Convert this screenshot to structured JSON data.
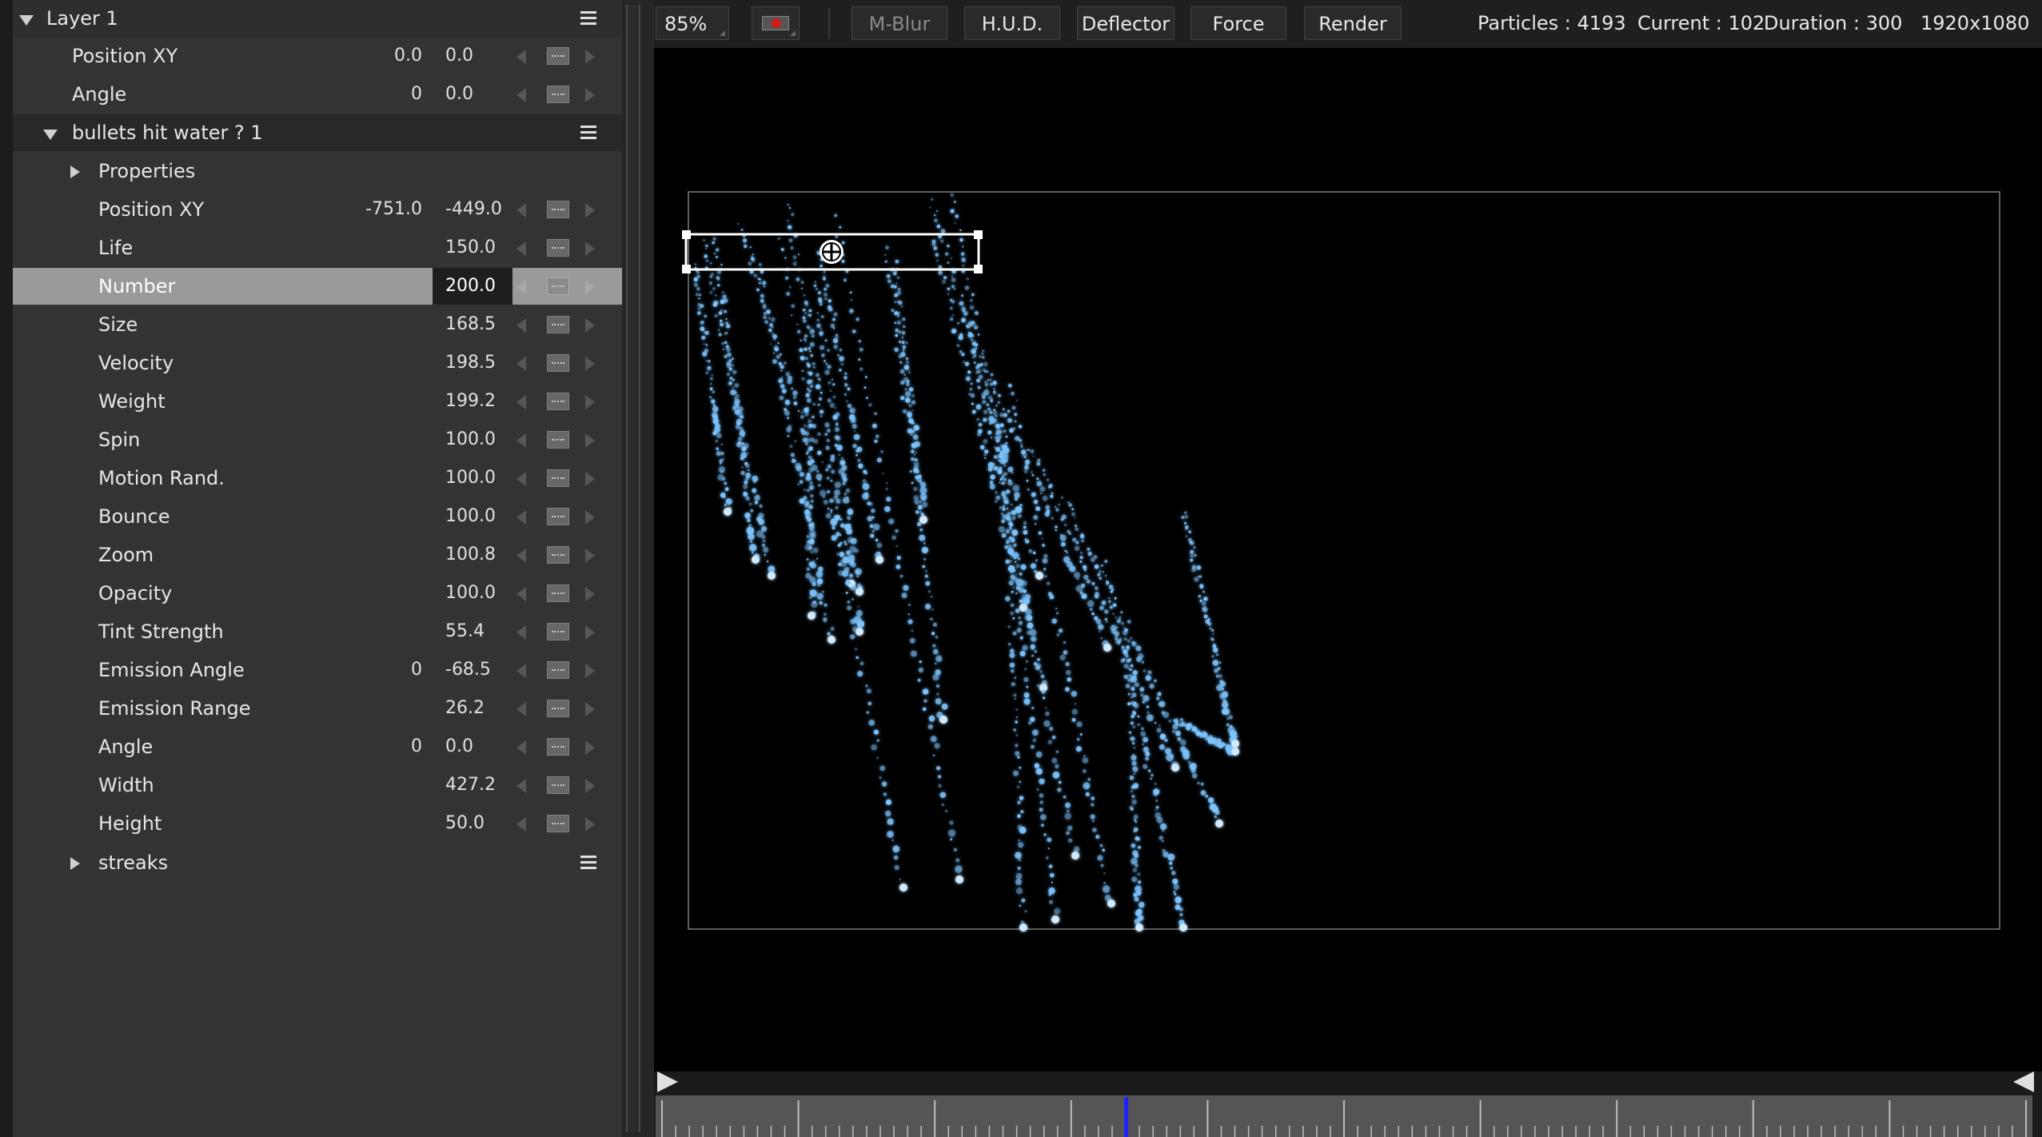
{
  "layers_panel": {
    "layer_title": "Layer 1",
    "layer_rows": [
      {
        "label": "Position XY",
        "v1": "0.0",
        "v2": "0.0"
      },
      {
        "label": "Angle",
        "v1": "0",
        "v2": "0.0"
      }
    ],
    "emitter_title": "bullets hit water ? 1",
    "properties_label": "Properties",
    "emitter_rows": [
      {
        "label": "Position XY",
        "v1": "-751.0",
        "v2": "-449.0"
      },
      {
        "label": "Life",
        "v1": "",
        "v2": "150.0"
      },
      {
        "label": "Number",
        "v1": "",
        "v2": "200.0"
      },
      {
        "label": "Size",
        "v1": "",
        "v2": "168.5"
      },
      {
        "label": "Velocity",
        "v1": "",
        "v2": "198.5"
      },
      {
        "label": "Weight",
        "v1": "",
        "v2": "199.2"
      },
      {
        "label": "Spin",
        "v1": "",
        "v2": "100.0"
      },
      {
        "label": "Motion Rand.",
        "v1": "",
        "v2": "100.0"
      },
      {
        "label": "Bounce",
        "v1": "",
        "v2": "100.0"
      },
      {
        "label": "Zoom",
        "v1": "",
        "v2": "100.8"
      },
      {
        "label": "Opacity",
        "v1": "",
        "v2": "100.0"
      },
      {
        "label": "Tint Strength",
        "v1": "",
        "v2": "55.4"
      },
      {
        "label": "Emission Angle",
        "v1": "0",
        "v2": "-68.5"
      },
      {
        "label": "Emission Range",
        "v1": "",
        "v2": "26.2"
      },
      {
        "label": "Angle",
        "v1": "0",
        "v2": "0.0"
      },
      {
        "label": "Width",
        "v1": "",
        "v2": "427.2"
      },
      {
        "label": "Height",
        "v1": "",
        "v2": "50.0"
      }
    ],
    "selected_row": "Number",
    "streaks_title": "streaks"
  },
  "toolbar": {
    "zoom": "85%",
    "buttons": [
      "M-Blur",
      "H.U.D.",
      "Deflector",
      "Force",
      "Render"
    ],
    "disabled_buttons": [
      "M-Blur"
    ],
    "particles": "Particles : 4193",
    "current": "Current : 102",
    "duration": "Duration : 300",
    "resolution": "1920x1080"
  },
  "timeline": {
    "current_frame": 102,
    "total_frames": 300
  },
  "colors": {
    "particle": "#7cc4ff",
    "cursor": "#2020ff",
    "record": "#d21a1a"
  },
  "icons": [
    "record-icon",
    "menu-icon",
    "expand-triangle-icon",
    "collapse-triangle-icon",
    "keyframe-icon",
    "prev-key-icon",
    "next-key-icon",
    "move-crosshair-icon"
  ]
}
